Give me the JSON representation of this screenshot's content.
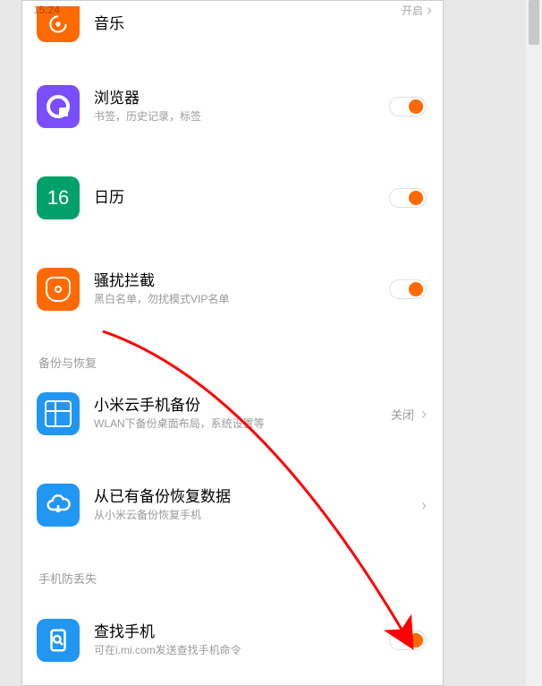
{
  "status": {
    "time": "15:24",
    "top_right_label": "开启"
  },
  "rows": {
    "music": {
      "title": "音乐"
    },
    "browser": {
      "title": "浏览器",
      "subtitle": "书签，历史记录，标签"
    },
    "calendar": {
      "title": "日历",
      "icon_text": "16"
    },
    "block": {
      "title": "骚扰拦截",
      "subtitle": "黑白名单，勿扰模式VIP名单"
    },
    "backup": {
      "title": "小米云手机备份",
      "subtitle": "WLAN下备份桌面布局，系统设置等",
      "tail": "关闭"
    },
    "restore": {
      "title": "从已有备份恢复数据",
      "subtitle": "从小米云备份恢复手机"
    },
    "find": {
      "title": "查找手机",
      "subtitle": "可在i.mi.com发送查找手机命令"
    }
  },
  "sections": {
    "backup_restore": "备份与恢复",
    "anti_lost": "手机防丢失"
  }
}
